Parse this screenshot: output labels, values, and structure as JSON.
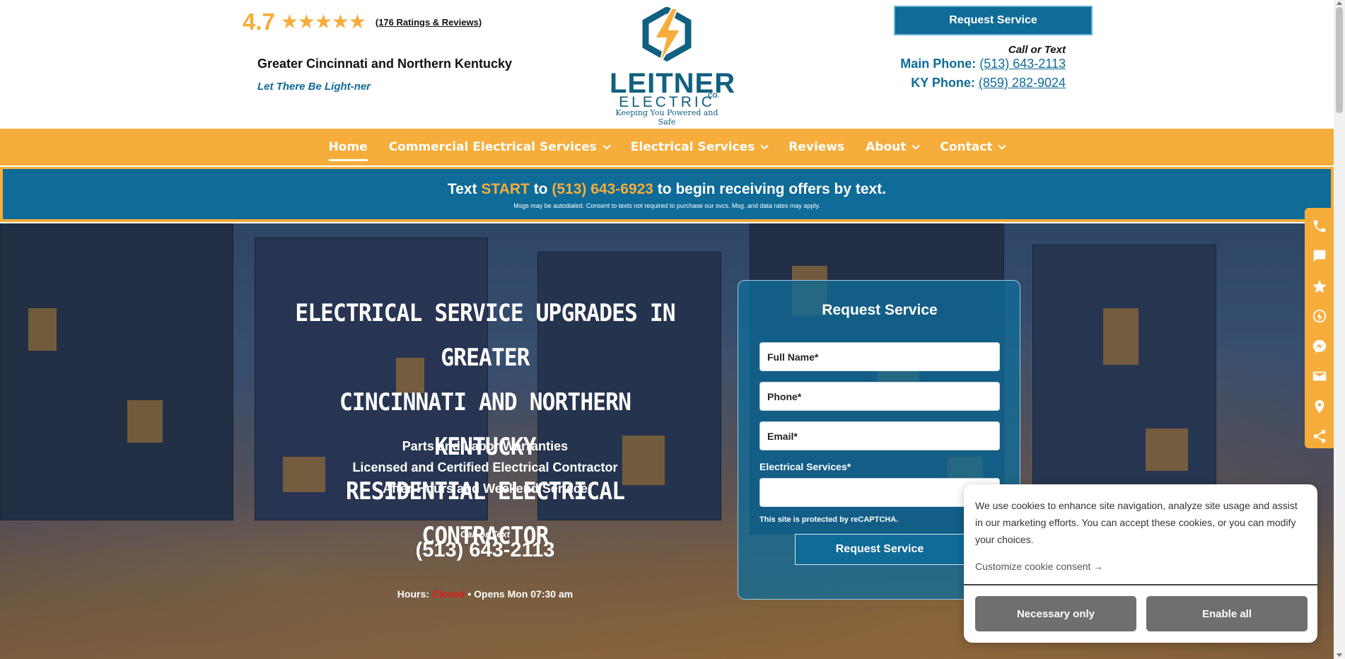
{
  "header": {
    "rating_score": "4.7",
    "rating_stars": 4.7,
    "rating_link": "(176 Ratings & Reviews)",
    "region": "Greater Cincinnati and Northern Kentucky",
    "tagline": "Let There Be Light-ner",
    "logo_main": "LEITNER",
    "logo_sub": "ELECTRIC",
    "logo_co": "CO.",
    "logo_slogan": "Keeping You Powered and Safe",
    "request_button": "Request Service",
    "call_or_text": "Call or Text",
    "main_phone_label": "Main Phone: ",
    "main_phone": "(513) 643-2113",
    "ky_phone_label": "KY Phone: ",
    "ky_phone": "(859) 282-9024"
  },
  "nav": {
    "items": [
      {
        "label": "Home"
      },
      {
        "label": "Commercial Electrical Services"
      },
      {
        "label": "Electrical Services"
      },
      {
        "label": "Reviews"
      },
      {
        "label": "About"
      },
      {
        "label": "Contact"
      }
    ]
  },
  "banner": {
    "text_pre": "Text ",
    "keyword": "START",
    "text_mid": " to ",
    "number": "(513) 643-6923",
    "text_post": " to begin receiving offers by text.",
    "fine_print": "Msgs may be autodialed. Consent to texts not required to purchase our svcs. Msg. and data rates may apply."
  },
  "hero": {
    "title_lines": [
      "ELECTRICAL SERVICE UPGRADES IN GREATER",
      "CINCINNATI AND NORTHERN KENTUCKY",
      "RESIDENTIAL ELECTRICAL CONTRACTOR"
    ],
    "bullets": [
      "Parts and Labor Warranties",
      "Licensed and Certified Electrical Contractor",
      "After-Hours and Weekend Service"
    ],
    "call_or_text": "Call or Text",
    "phone": "(513) 643-2113",
    "hours_label": "Hours: ",
    "hours_status": "Closed",
    "hours_next": " • Opens Mon 07:30 am"
  },
  "form": {
    "title": "Request Service",
    "full_name_placeholder": "Full Name*",
    "phone_placeholder": "Phone*",
    "email_placeholder": "Email*",
    "services_label": "Electrical Services*",
    "services_value": "",
    "recaptcha": "This site is protected by reCAPTCHA.",
    "submit": "Request Service"
  },
  "sidebar": {
    "icons": [
      "phone-icon",
      "chat-icon",
      "star-icon",
      "bolt-icon",
      "messenger-icon",
      "mail-icon",
      "map-pin-icon",
      "share-icon"
    ]
  },
  "cookie": {
    "text": "We use cookies to enhance site navigation, analyze site usage and assist in our marketing efforts. You can accept these cookies, or you can modify your choices.",
    "customize": "Customize cookie consent →",
    "necessary": "Necessary only",
    "enable_all": "Enable all"
  },
  "colors": {
    "brand_blue": "#0f6b98",
    "brand_orange": "#f6ad3b",
    "closed_red": "#e31b1b"
  }
}
